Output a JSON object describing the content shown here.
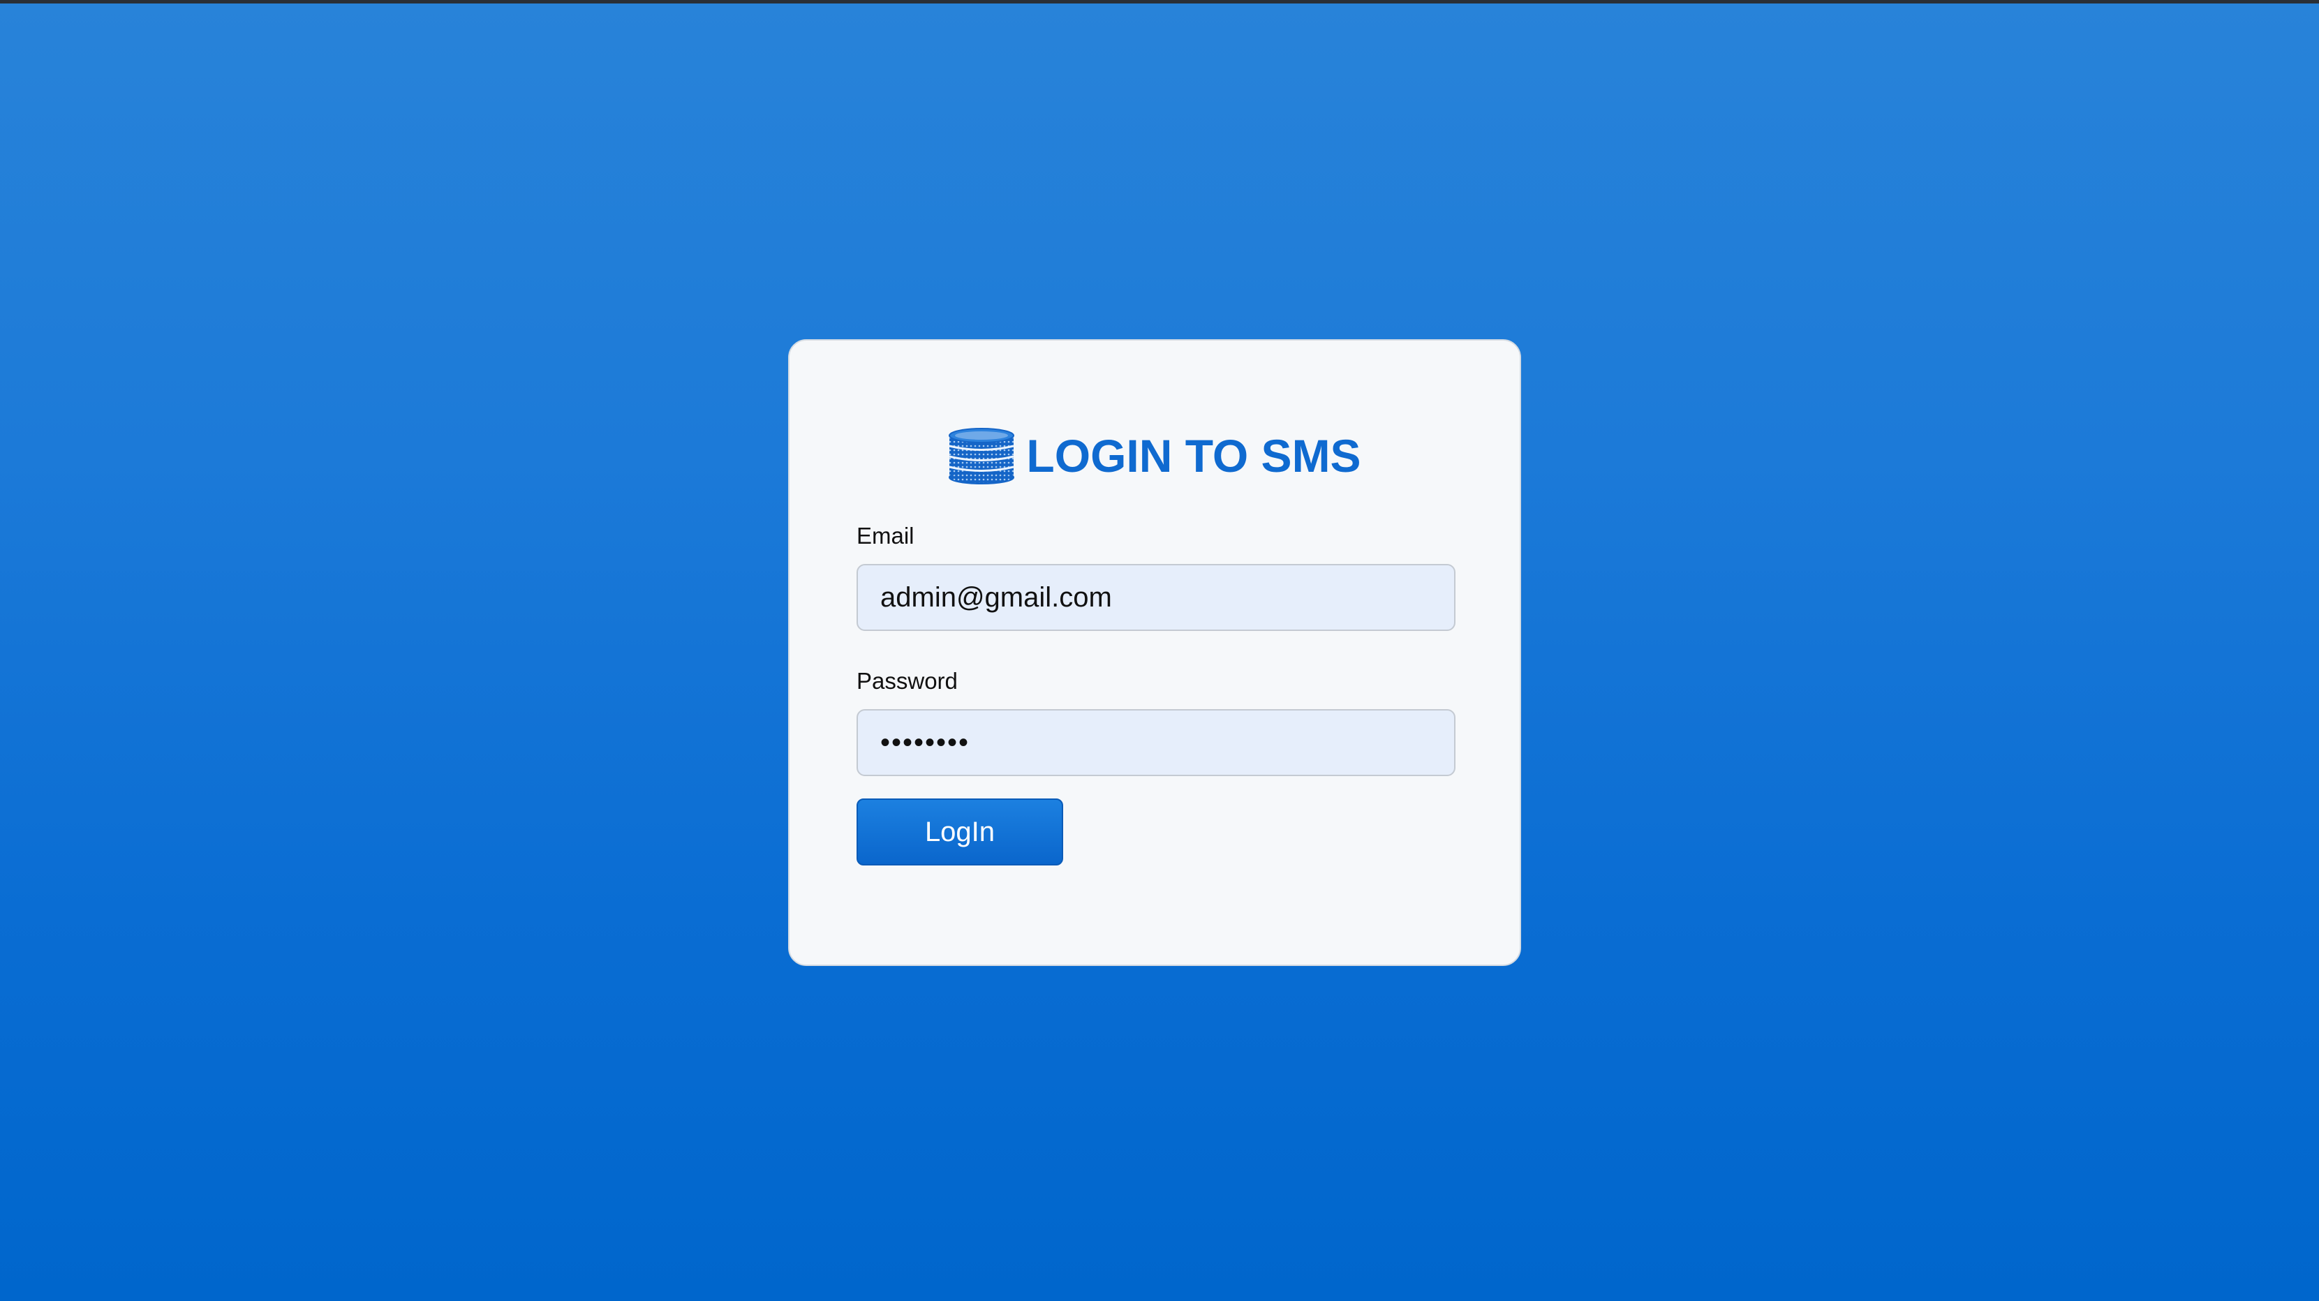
{
  "login": {
    "title": "LOGIN TO SMS",
    "title_icon": "database-icon",
    "email_label": "Email",
    "email_value": "admin@gmail.com",
    "password_label": "Password",
    "password_value": "••••••••",
    "login_button_label": "LogIn"
  },
  "colors": {
    "accent": "#0f6ad0",
    "background_top": "#2883d9",
    "background_bottom": "#0066cc",
    "card_background": "#f6f8fa",
    "field_background": "#e6eefb"
  }
}
